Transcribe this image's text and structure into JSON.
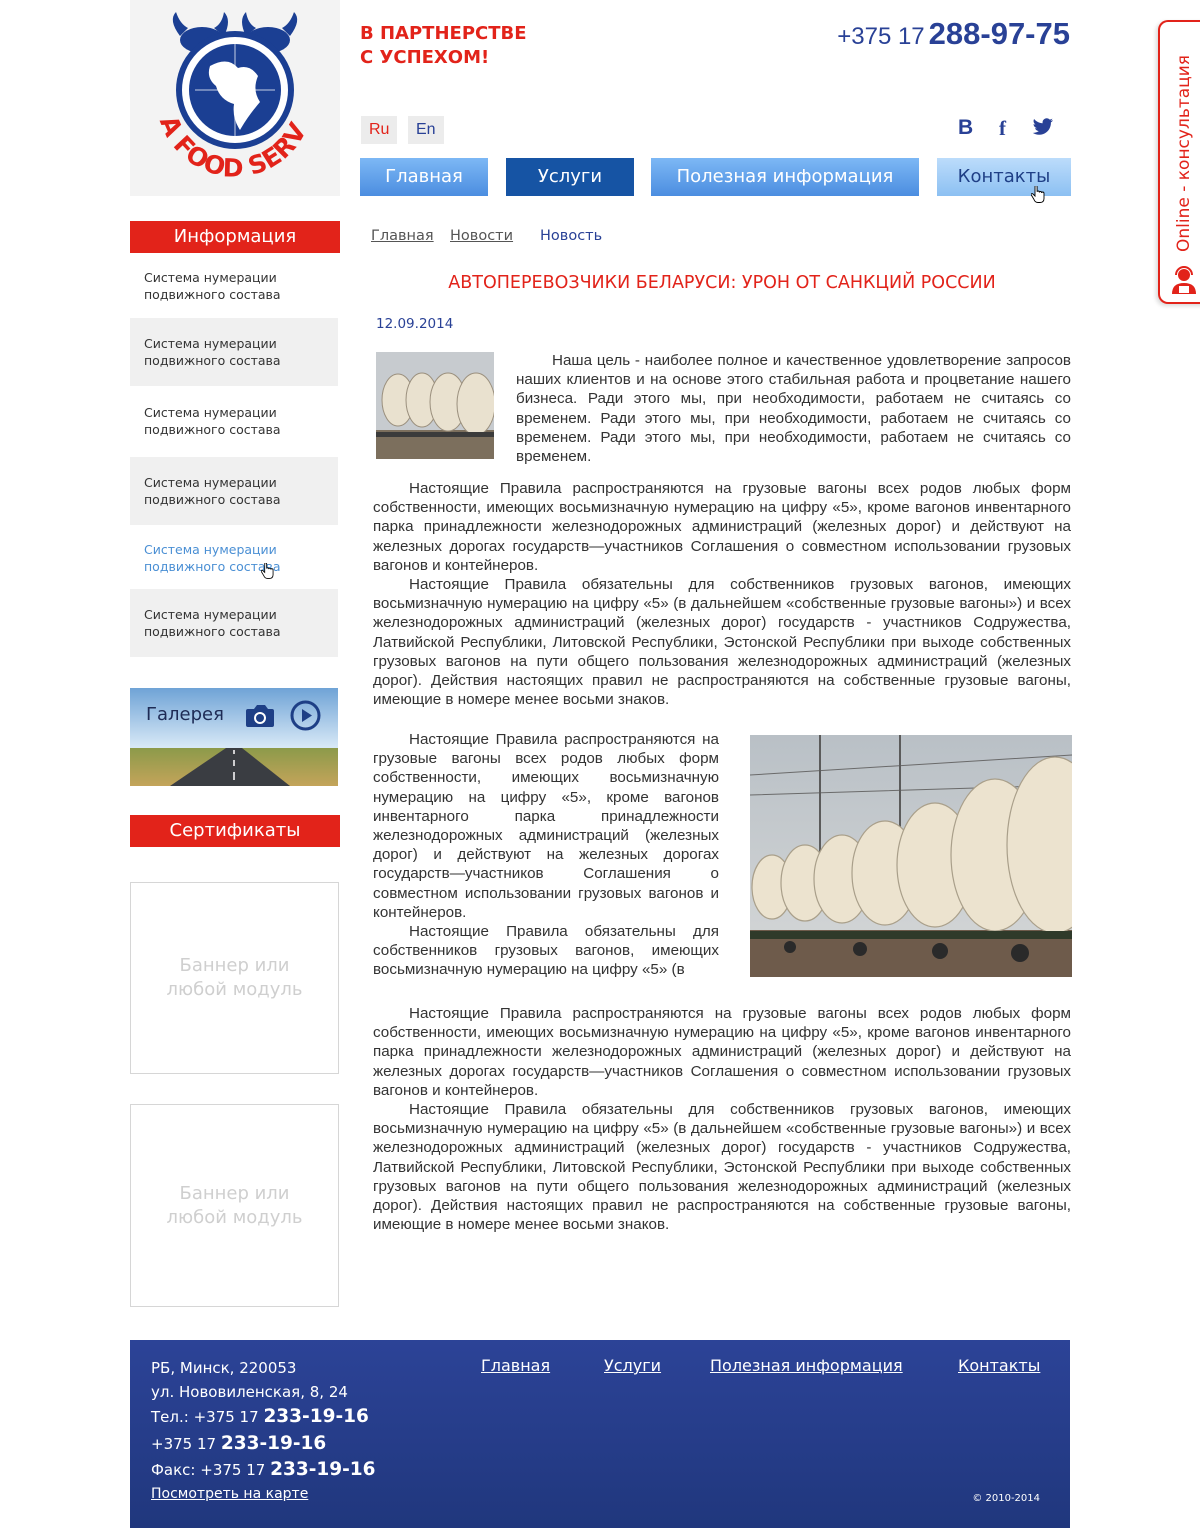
{
  "header": {
    "logo_text": "SEA FOOD SERVICE",
    "slogan_line1": "В ПАРТНЕРСТВЕ",
    "slogan_line2": "С УСПЕХОМ!",
    "phone_code": "+375 17",
    "phone_number": "288-97-75",
    "lang_ru": "Ru",
    "lang_en": "En",
    "social": {
      "vk": "В",
      "facebook": "f",
      "twitter": "twitter"
    }
  },
  "nav": [
    {
      "label": "Главная"
    },
    {
      "label": "Услуги"
    },
    {
      "label": "Полезная информация"
    },
    {
      "label": "Контакты"
    }
  ],
  "online_tab": {
    "label": "Online - консультация"
  },
  "sidebar": {
    "info_title": "Информация",
    "items": [
      {
        "label": "Система нумерации подвижного состава"
      },
      {
        "label": "Система нумерации подвижного состава"
      },
      {
        "label": "Система нумерации подвижного состава"
      },
      {
        "label": "Система нумерации подвижного состава"
      },
      {
        "label": "Система нумерации подвижного состава"
      },
      {
        "label": "Система нумерации подвижного состава"
      }
    ],
    "gallery_label": "Галерея",
    "certificates_title": "Сертификаты",
    "banners": [
      {
        "text": "Баннер или любой модуль"
      },
      {
        "text": "Баннер или любой модуль"
      }
    ]
  },
  "breadcrumb": {
    "home": "Главная",
    "news": "Новости",
    "current": "Новость"
  },
  "article": {
    "title": "АВТОПЕРЕВОЗЧИКИ БЕЛАРУСИ: УРОН ОТ САНКЦИЙ РОССИИ",
    "date": "12.09.2014",
    "intro": "Наша цель - наиболее полное и качественное удовлетворение запросов наших клиентов и на основе этого стабильная работа и процветание нашего бизнеса. Ради этого мы, при необходимости, работаем не считаясь со временем. Ради этого мы, при необходимости, работаем не считаясь со временем. Ради этого мы, при необходимости, работаем не считаясь со временем.",
    "p1": "Настоящие Правила распространяются на грузовые вагоны всех родов любых форм собственности, имеющих восьмизначную нумерацию на цифру «5», кроме вагонов инвентарного парка принадлежности железнодорожных администраций (железных дорог) и действуют на железных дорогах государств—участников Соглашения о совместном использовании грузовых вагонов и контейнеров.",
    "p2": "Настоящие Правила обязательны для собственников грузовых вагонов, имеющих восьмизначную нумерацию на цифру «5» (в дальнейшем «собственные грузовые вагоны») и всех железнодорожных администраций (железных дорог) государств - участников Содружества, Латвийской Республики, Литовской Республики, Эстонской Республики при выходе собственных грузовых вагонов на пути общего пользования железнодорожных администраций (железных дорог). Действия настоящих правил не распространяются на собственные грузовые вагоны, имеющие в номере менее восьми знаков.",
    "p3": "Настоящие Правила распространяются на грузовые вагоны всех родов любых форм собственности, имеющих восьмизначную нумерацию на цифру «5», кроме вагонов инвентарного парка принадлежности железнодорожных администраций (железных дорог) и действуют на железных дорогах государств—участников Соглашения о совместном использовании грузовых вагонов и контейнеров.",
    "p4": "Настоящие Правила обязательны для собственников грузовых вагонов, имеющих восьмизначную нумерацию на цифру «5» (в",
    "p5": "Настоящие Правила распространяются на грузовые вагоны всех родов любых форм собственности, имеющих восьмизначную нумерацию на цифру «5», кроме вагонов инвентарного парка принадлежности железнодорожных администраций (железных дорог) и действуют на железных дорогах государств—участников Соглашения о совместном использовании грузовых вагонов и контейнеров.",
    "p6": "Настоящие Правила обязательны для собственников грузовых вагонов, имеющих восьмизначную нумерацию на цифру «5» (в дальнейшем «собственные грузовые вагоны») и всех железнодорожных администраций (железных дорог) государств - участников Содружества, Латвийской Республики, Литовской Республики, Эстонской Республики при выходе собственных грузовых вагонов на пути общего пользования железнодорожных администраций (железных дорог). Действия настоящих правил не распространяются на собственные грузовые вагоны, имеющие в номере менее восьми знаков."
  },
  "footer": {
    "address_line1": "РБ, Минск, 220053",
    "address_line2": "ул. Нововиленская, 8, 24",
    "tel_label": "Тел.:",
    "tel_code": "+375 17",
    "tel_number": "233-19-16",
    "tel2_code": "+375 17",
    "tel2_number": "233-19-16",
    "fax_label": "Факс:",
    "fax_code": "+375 17",
    "fax_number": "233-19-16",
    "map_link": "Посмотреть на карте",
    "nav": [
      {
        "label": "Главная"
      },
      {
        "label": "Услуги"
      },
      {
        "label": "Полезная информация"
      },
      {
        "label": "Контакты"
      }
    ],
    "copyright": "© 2010-2014"
  },
  "colors": {
    "brand_red": "#e2231a",
    "brand_blue": "#294196",
    "nav_active": "#1654a4",
    "footer_bg": "#2c4397"
  }
}
